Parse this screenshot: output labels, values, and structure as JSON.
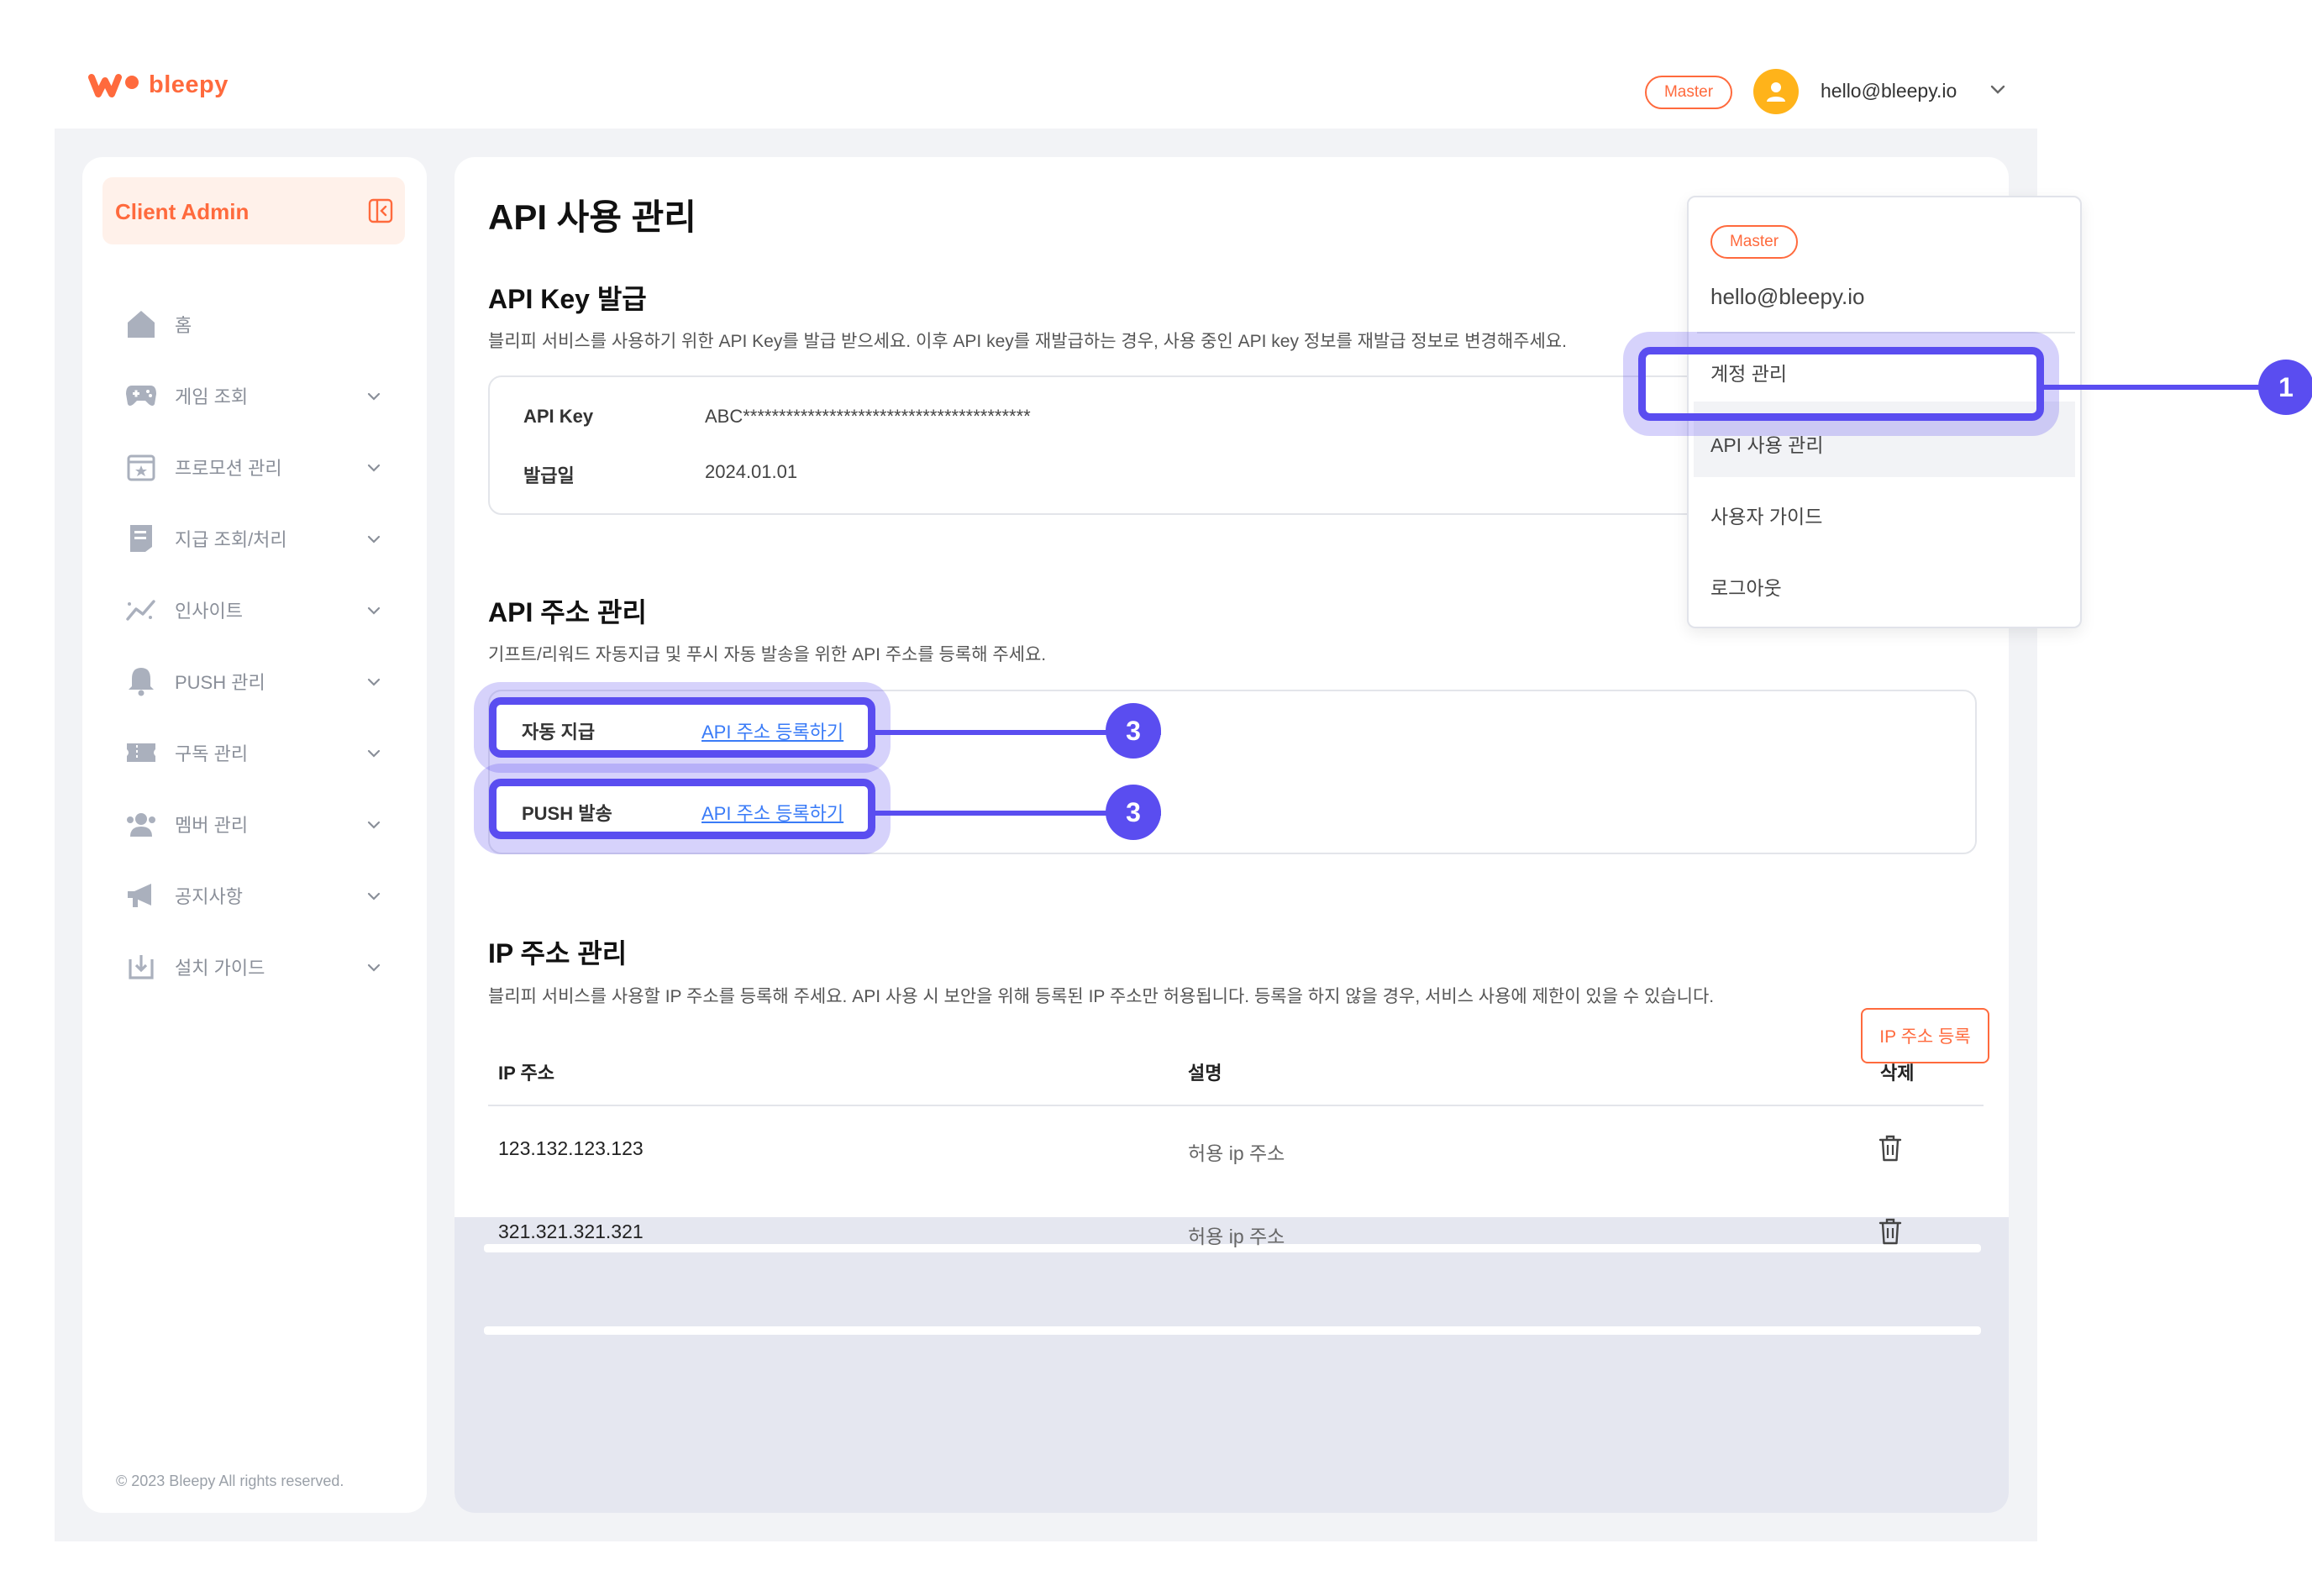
{
  "header": {
    "logo_text": "bleepy",
    "role_badge": "Master",
    "user_email": "hello@bleepy.io"
  },
  "sidebar": {
    "title": "Client Admin",
    "items": [
      {
        "label": "홈",
        "icon": "home-icon"
      },
      {
        "label": "게임 조회",
        "icon": "gamepad-icon"
      },
      {
        "label": "프로모션 관리",
        "icon": "calendar-star-icon"
      },
      {
        "label": "지급 조회/처리",
        "icon": "receipt-icon"
      },
      {
        "label": "인사이트",
        "icon": "chart-line-icon"
      },
      {
        "label": "PUSH 관리",
        "icon": "bell-icon"
      },
      {
        "label": "구독 관리",
        "icon": "ticket-icon"
      },
      {
        "label": "멤버 관리",
        "icon": "users-icon"
      },
      {
        "label": "공지사항",
        "icon": "megaphone-icon"
      },
      {
        "label": "설치 가이드",
        "icon": "download-icon"
      }
    ],
    "copyright": "© 2023 Bleepy All rights reserved."
  },
  "main": {
    "page_title": "API 사용 관리",
    "api_key_section": {
      "title": "API Key 발급",
      "description": "블리피 서비스를 사용하기 위한 API Key를 발급 받으세요. 이후 API key를 재발급하는 경우, 사용 중인 API key 정보를 재발급 정보로 변경해주세요.",
      "key_label": "API Key",
      "key_value": "ABC****************************************",
      "date_label": "발급일",
      "date_value": "2024.01.01"
    },
    "api_address_section": {
      "title": "API 주소 관리",
      "description": "기프트/리워드 자동지급 및 푸시 자동 발송을 위한 API 주소를 등록해 주세요.",
      "rows": [
        {
          "label": "자동 지급",
          "link": "API 주소 등록하기"
        },
        {
          "label": "PUSH 발송",
          "link": "API 주소 등록하기"
        }
      ]
    },
    "ip_section": {
      "title": "IP  주소 관리",
      "description": "블리피 서비스를 사용할 IP 주소를 등록해 주세요. API 사용 시 보안을 위해 등록된 IP 주소만 허용됩니다. 등록을 하지 않을 경우, 서비스 사용에 제한이 있을 수 있습니다.",
      "register_button": "IP 주소 등록",
      "columns": [
        "IP 주소",
        "설명",
        "삭제"
      ],
      "rows": [
        {
          "ip": "123.132.123.123",
          "desc": "허용 ip 주소"
        },
        {
          "ip": "321.321.321.321",
          "desc": "허용 ip 주소"
        }
      ]
    }
  },
  "dropdown": {
    "role_badge": "Master",
    "email": "hello@bleepy.io",
    "items": [
      "계정 관리",
      "API 사용 관리",
      "사용자 가이드",
      "로그아웃"
    ]
  },
  "annotations": {
    "marker_1": "1",
    "marker_3a": "3",
    "marker_3b": "3"
  },
  "colors": {
    "brand": "#ff6a3d",
    "highlight": "#5a4df0",
    "link": "#3a7bf7"
  }
}
